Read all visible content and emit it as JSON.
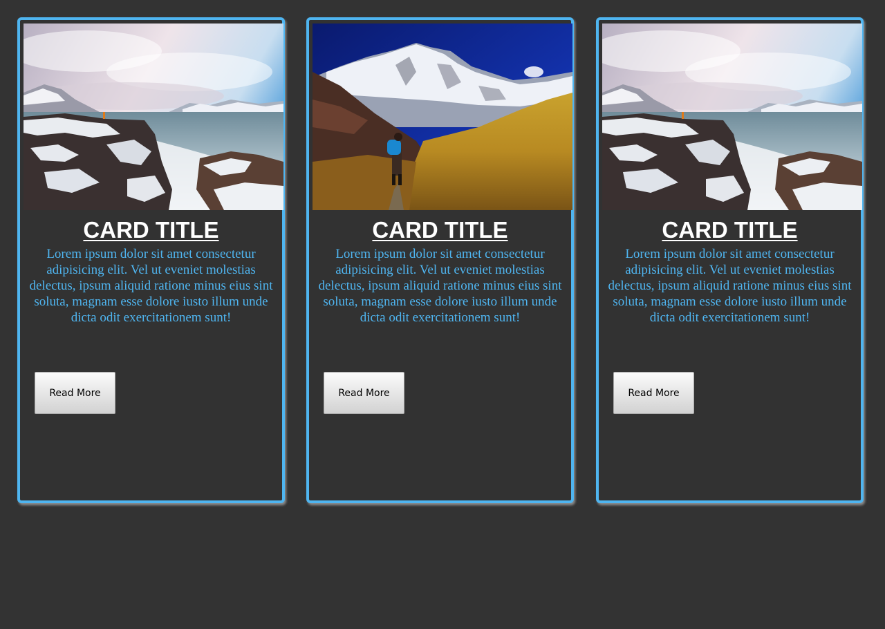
{
  "colors": {
    "background": "#333333",
    "card_border": "#4fb5f0",
    "title": "#ffffff",
    "body_text": "#4fb5f0"
  },
  "cards": [
    {
      "image": "snowy-coastline-photo",
      "title": "CARD TITLE",
      "text": "Lorem ipsum dolor sit amet consectetur adipisicing elit. Vel ut eveniet molestias delectus, ipsum aliquid ratione minus eius sint soluta, magnam esse dolore iusto illum unde dicta odit exercitationem sunt!",
      "button_label": "Read More"
    },
    {
      "image": "mountain-hiker-photo",
      "title": "CARD TITLE",
      "text": "Lorem ipsum dolor sit amet consectetur adipisicing elit. Vel ut eveniet molestias delectus, ipsum aliquid ratione minus eius sint soluta, magnam esse dolore iusto illum unde dicta odit exercitationem sunt!",
      "button_label": "Read More"
    },
    {
      "image": "snowy-coastline-photo",
      "title": "CARD TITLE",
      "text": "Lorem ipsum dolor sit amet consectetur adipisicing elit. Vel ut eveniet molestias delectus, ipsum aliquid ratione minus eius sint soluta, magnam esse dolore iusto illum unde dicta odit exercitationem sunt!",
      "button_label": "Read More"
    }
  ]
}
